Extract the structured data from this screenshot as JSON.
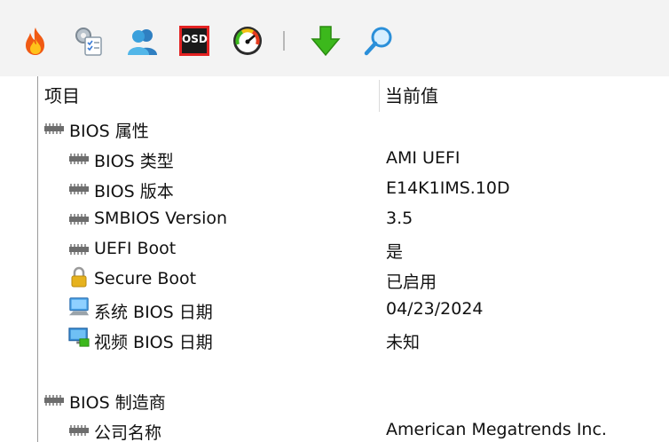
{
  "toolbar": {
    "buttons": [
      {
        "name": "flame-icon"
      },
      {
        "name": "settings-checklist-icon"
      },
      {
        "name": "users-icon"
      },
      {
        "name": "osd-icon",
        "label": "OSD"
      },
      {
        "name": "speedometer-icon"
      },
      {
        "name": "download-arrow-icon"
      },
      {
        "name": "search-icon"
      }
    ]
  },
  "list": {
    "header": {
      "item": "项目",
      "value": "当前值"
    },
    "rows": [
      {
        "name": "BIOS 属性",
        "value": "",
        "icon": "chip-icon",
        "level": 0
      },
      {
        "name": "BIOS 类型",
        "value": "AMI UEFI",
        "icon": "chip-icon",
        "level": 1
      },
      {
        "name": "BIOS 版本",
        "value": "E14K1IMS.10D",
        "icon": "chip-icon",
        "level": 1
      },
      {
        "name": "SMBIOS Version",
        "value": "3.5",
        "icon": "chip-icon",
        "level": 1
      },
      {
        "name": "UEFI Boot",
        "value": "是",
        "icon": "chip-icon",
        "level": 1
      },
      {
        "name": "Secure Boot",
        "value": "已启用",
        "icon": "lock-icon",
        "level": 1
      },
      {
        "name": "系统 BIOS 日期",
        "value": "04/23/2024",
        "icon": "computer-icon",
        "level": 1
      },
      {
        "name": "视频 BIOS 日期",
        "value": "未知",
        "icon": "monitor-icon",
        "level": 1
      },
      {
        "name": "BIOS 制造商",
        "value": "",
        "icon": "chip-icon",
        "level": 0
      },
      {
        "name": "公司名称",
        "value": "American Megatrends Inc.",
        "icon": "chip-icon",
        "level": 1
      }
    ]
  },
  "colors": {
    "toolbar_bg": "#f3f3f3",
    "chip": "#6d6d6d",
    "accent_green": "#3cb81c",
    "lock": "#e6b21e"
  }
}
